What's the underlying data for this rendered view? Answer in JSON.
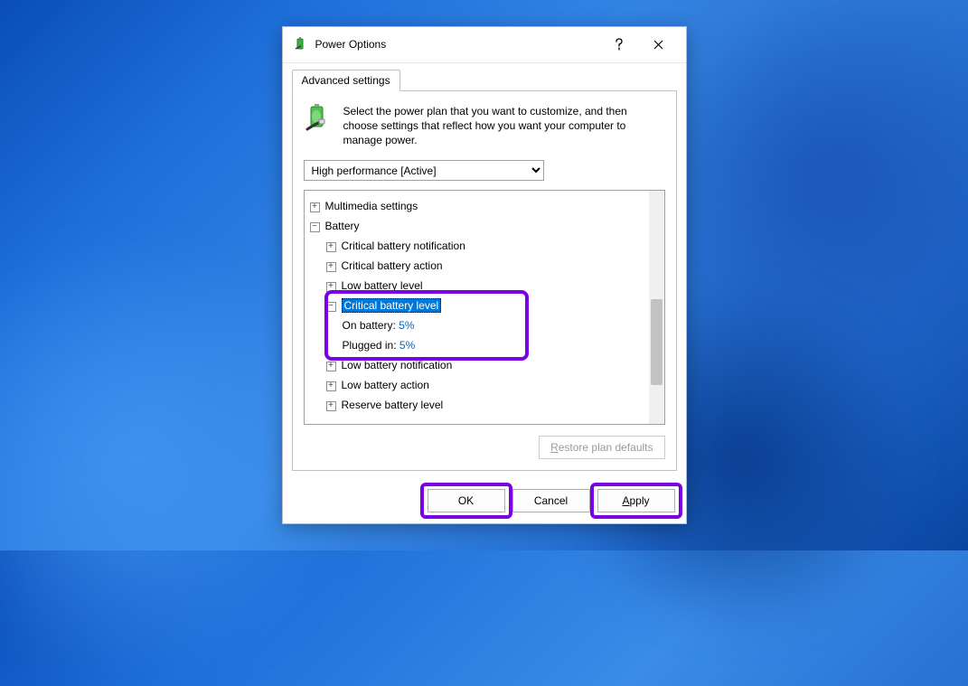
{
  "window": {
    "title": "Power Options"
  },
  "tab": {
    "label": "Advanced settings"
  },
  "intro": "Select the power plan that you want to customize, and then choose settings that reflect how you want your computer to manage power.",
  "plan": {
    "selected": "High performance [Active]"
  },
  "tree": {
    "multimedia": "Multimedia settings",
    "battery": "Battery",
    "crit_notif": "Critical battery notification",
    "crit_action": "Critical battery action",
    "low_level": "Low battery level",
    "crit_level": "Critical battery level",
    "on_battery_label": "On battery:",
    "on_battery_value": "5%",
    "plugged_label": "Plugged in:",
    "plugged_value": "5%",
    "low_notif": "Low battery notification",
    "low_action": "Low battery action",
    "reserve": "Reserve battery level"
  },
  "restore_label": "Restore plan defaults",
  "buttons": {
    "ok": "OK",
    "cancel": "Cancel",
    "apply_pre": "A",
    "apply_post": "pply"
  }
}
